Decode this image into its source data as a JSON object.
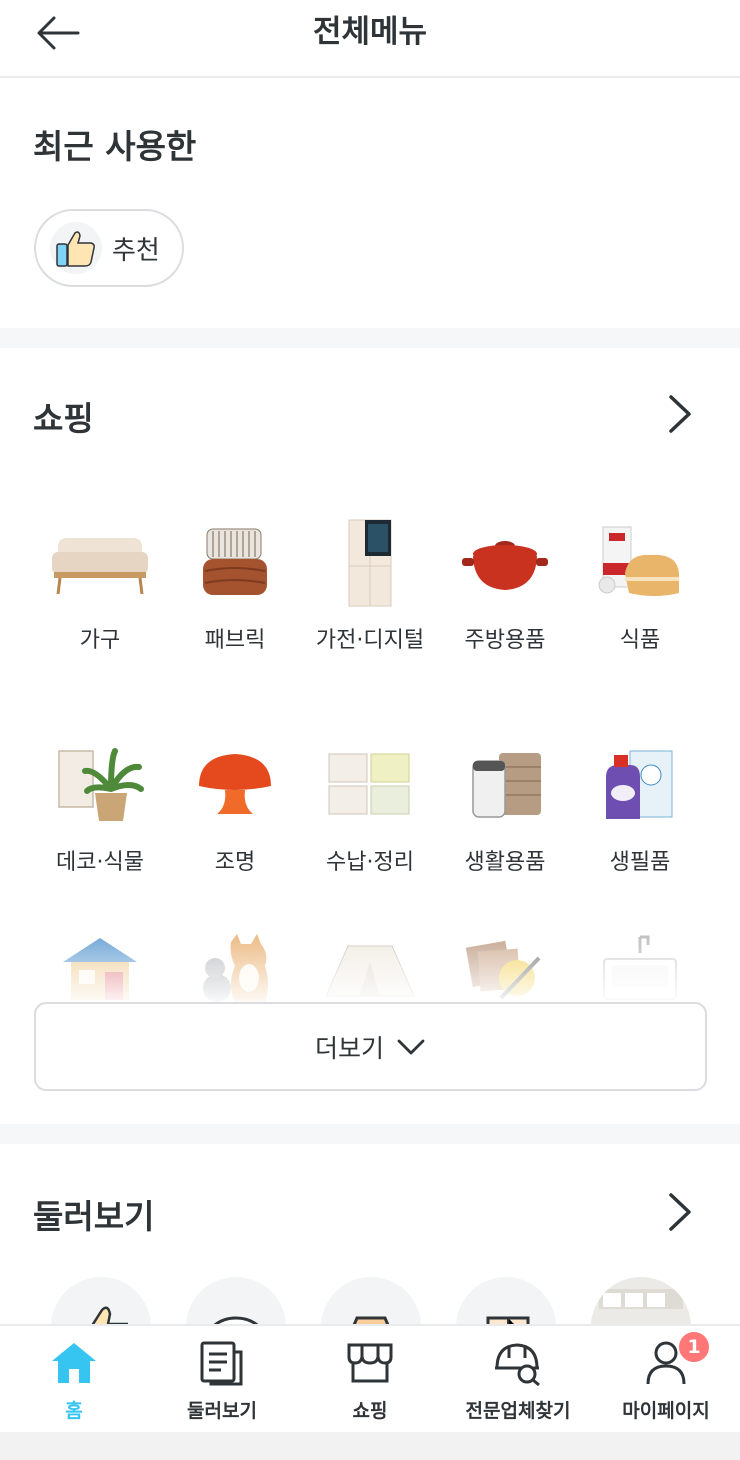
{
  "header": {
    "title": "전체메뉴"
  },
  "recent": {
    "title": "최근 사용한",
    "chips": [
      {
        "label": "추천",
        "icon": "thumbs-up-icon"
      }
    ]
  },
  "shopping": {
    "title": "쇼핑",
    "categories": [
      {
        "label": "가구",
        "icon": "sofa"
      },
      {
        "label": "패브릭",
        "icon": "pillow-blanket"
      },
      {
        "label": "가전·디지털",
        "icon": "fridge"
      },
      {
        "label": "주방용품",
        "icon": "pot"
      },
      {
        "label": "식품",
        "icon": "bread"
      },
      {
        "label": "데코·식물",
        "icon": "plant"
      },
      {
        "label": "조명",
        "icon": "mushroom-lamp"
      },
      {
        "label": "수납·정리",
        "icon": "storage-boxes"
      },
      {
        "label": "생활용품",
        "icon": "trash-can-towels"
      },
      {
        "label": "생필품",
        "icon": "detergent-tissue"
      },
      {
        "label": "",
        "icon": "playhouse"
      },
      {
        "label": "",
        "icon": "pets"
      },
      {
        "label": "",
        "icon": "tent"
      },
      {
        "label": "",
        "icon": "tiles-brush"
      },
      {
        "label": "",
        "icon": "sink"
      }
    ],
    "more_label": "더보기"
  },
  "browse": {
    "title": "둘러보기"
  },
  "tabbar": {
    "items": [
      {
        "label": "홈",
        "active": true
      },
      {
        "label": "둘러보기",
        "active": false
      },
      {
        "label": "쇼핑",
        "active": false
      },
      {
        "label": "전문업체찾기",
        "active": false
      },
      {
        "label": "마이페이지",
        "active": false
      }
    ],
    "badge": "1"
  },
  "colors": {
    "accent": "#35c5f0",
    "badge": "#ff7777",
    "text": "#2f3438",
    "divider": "#f5f7f8"
  }
}
